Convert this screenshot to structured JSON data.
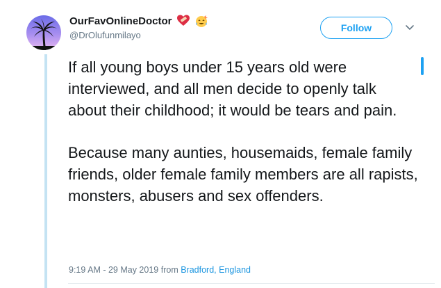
{
  "author": {
    "display_name": "OurFavOnlineDoctor",
    "handle": "@DrOlufunmilayo",
    "emojis": [
      "heart-with-bandage-icon",
      "face-with-tears-icon"
    ]
  },
  "actions": {
    "follow_label": "Follow"
  },
  "tweet": {
    "paragraphs": [
      "If all young boys under 15 years old were interviewed, and all men decide to openly talk about their childhood; it would be tears and pain.",
      "Because many aunties, housemaids, female family friends, older female family members are all rapists, monsters, abusers and sex offenders."
    ],
    "timestamp": "9:19 AM - 29 May 2019",
    "from_label": "from",
    "location": "Bradford, England"
  },
  "colors": {
    "accent": "#1da1f2",
    "thread_line": "#c4e3f3",
    "secondary_text": "#657786"
  }
}
